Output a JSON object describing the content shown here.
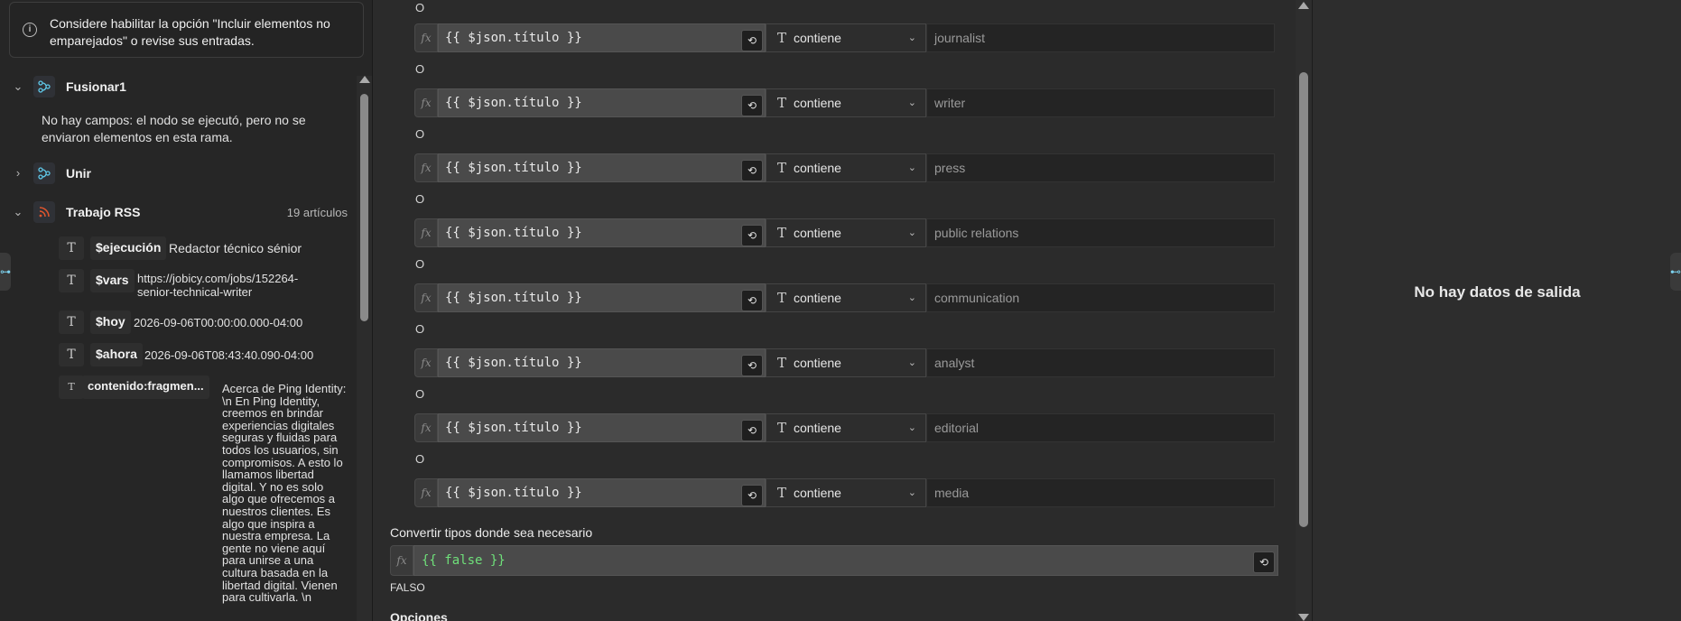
{
  "left_panel": {
    "warning_text": "Considere habilitar la opción \"Incluir elementos no emparejados\" o revise sus entradas.",
    "nodes": [
      {
        "label": "Fusionar1",
        "chevron": "v",
        "icon": "merge-icon"
      },
      {
        "label": "Unir",
        "chevron": ">",
        "icon": "merge-icon"
      },
      {
        "label": "Trabajo RSS",
        "chevron": "v",
        "icon": "rss-icon",
        "count": "19 artículos"
      }
    ],
    "fusionar_message": "No hay campos: el nodo se ejecutó, pero no se enviaron elementos en esta rama.",
    "fields": [
      {
        "type": "T",
        "name": "$ejecución",
        "value": "Redactor técnico sénior"
      },
      {
        "type": "T",
        "name": "$vars",
        "value": "https://jobicy.com/jobs/152264-senior-technical-writer"
      },
      {
        "type": "T",
        "name": "$hoy",
        "value": "2026-09-06T00:00:00.000-04:00"
      },
      {
        "type": "T",
        "name": "$ahora",
        "value": "2026-09-06T08:43:40.090-04:00"
      },
      {
        "type": "T",
        "name": "contenido:fragmen...",
        "value": "Acerca de Ping Identity: \\n En Ping Identity, creemos en brindar experiencias digitales seguras y fluidas para todos los usuarios, sin compromisos. A esto lo llamamos libertad digital. Y no es solo algo que ofrecemos a nuestros clientes. Es algo que inspira a nuestra empresa. La gente no viene aquí para unirse a una cultura basada en la libertad digital. Vienen para cultivarla. \\n"
      }
    ]
  },
  "middle_panel": {
    "top_or": "O",
    "conditions": [
      {
        "expression": "{{ $json.título }}",
        "operator": "contiene",
        "value": "journalist"
      },
      {
        "expression": "{{ $json.título }}",
        "operator": "contiene",
        "value": "writer"
      },
      {
        "expression": "{{ $json.título }}",
        "operator": "contiene",
        "value": "press"
      },
      {
        "expression": "{{ $json.título }}",
        "operator": "contiene",
        "value": "public relations"
      },
      {
        "expression": "{{ $json.título }}",
        "operator": "contiene",
        "value": "communication"
      },
      {
        "expression": "{{ $json.título }}",
        "operator": "contiene",
        "value": "analyst"
      },
      {
        "expression": "{{ $json.título }}",
        "operator": "contiene",
        "value": "editorial"
      },
      {
        "expression": "{{ $json.título }}",
        "operator": "contiene",
        "value": "media"
      }
    ],
    "or_label": "O",
    "fx_label": "fx",
    "type_letter": "T",
    "convert_label": "Convertir tipos donde sea necesario",
    "convert_expression": "{{ false }}",
    "convert_result": "FALSO",
    "options_label": "Opciones"
  },
  "right_panel": {
    "empty_message": "No hay datos de salida"
  },
  "colors": {
    "expression_green": "#6fe07a",
    "link_icon": "#7dd3f0"
  }
}
